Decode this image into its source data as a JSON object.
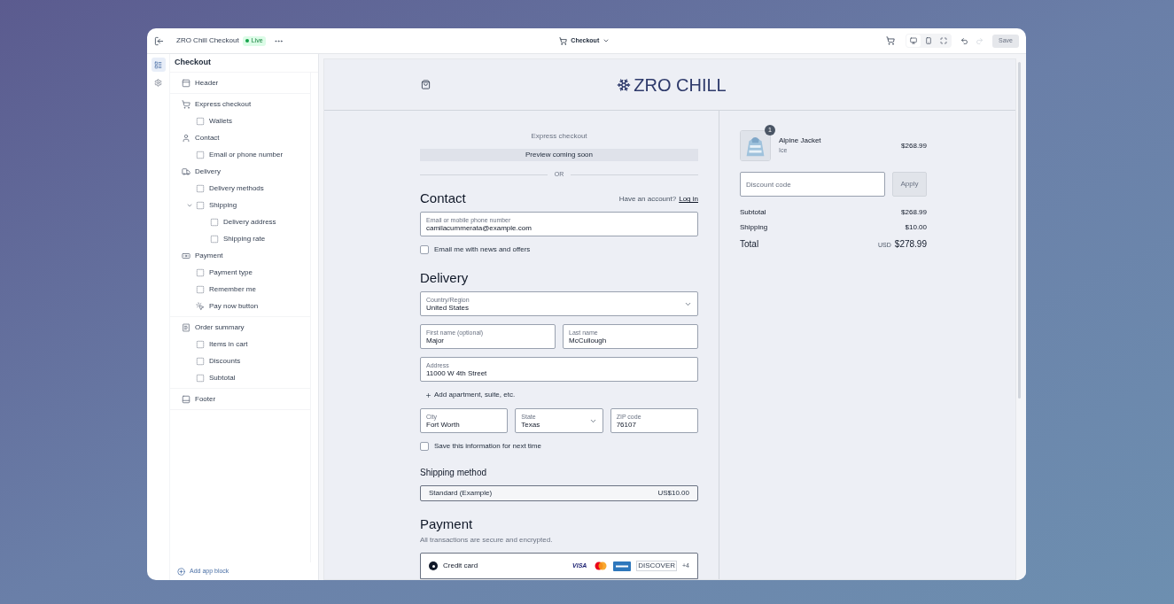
{
  "topbar": {
    "title": "ZRO Chill Checkout",
    "status": "Live",
    "page": "Checkout",
    "save": "Save",
    "save_disabled": true,
    "redo_disabled": true,
    "devices": [
      {
        "kind": "desktop",
        "selected": true
      },
      {
        "kind": "mobile",
        "selected": false
      },
      {
        "kind": "fullscreen",
        "selected": false
      }
    ]
  },
  "rail": [
    {
      "kind": "sections",
      "selected": true
    },
    {
      "kind": "settings",
      "selected": false
    }
  ],
  "sidebar": {
    "title": "Checkout",
    "groups": [
      [
        {
          "kind": "header",
          "label": "Header"
        }
      ],
      [
        {
          "kind": "cart",
          "label": "Express checkout",
          "children": [
            {
              "kind": "block",
              "label": "Wallets"
            }
          ]
        },
        {
          "kind": "person",
          "label": "Contact",
          "children": [
            {
              "kind": "block",
              "label": "Email or phone number"
            }
          ]
        },
        {
          "kind": "truck",
          "label": "Delivery",
          "children": [
            {
              "kind": "block",
              "label": "Delivery methods"
            },
            {
              "kind": "block",
              "label": "Shipping",
              "expanded": true,
              "children": [
                {
                  "kind": "block",
                  "label": "Delivery address"
                },
                {
                  "kind": "block",
                  "label": "Shipping rate"
                }
              ]
            }
          ]
        },
        {
          "kind": "cash",
          "label": "Payment",
          "children": [
            {
              "kind": "block",
              "label": "Payment type"
            },
            {
              "kind": "block",
              "label": "Remember me"
            },
            {
              "kind": "button",
              "label": "Pay now button"
            }
          ]
        }
      ],
      [
        {
          "kind": "receipt",
          "label": "Order summary",
          "children": [
            {
              "kind": "block",
              "label": "Items in cart"
            },
            {
              "kind": "block",
              "label": "Discounts"
            },
            {
              "kind": "block",
              "label": "Subtotal"
            }
          ]
        }
      ],
      [
        {
          "kind": "footer",
          "label": "Footer"
        }
      ]
    ],
    "add_block": "Add app block"
  },
  "preview": {
    "brand": "ZRO CHILL",
    "express": {
      "title": "Express checkout",
      "placeholder": "Preview coming soon",
      "divider": "OR"
    },
    "contact": {
      "heading": "Contact",
      "account_prompt": "Have an account?",
      "login": "Log in",
      "email": {
        "label": "Email or mobile phone number",
        "value": "camilacummerata@example.com"
      },
      "news": {
        "label": "Email me with news and offers",
        "checked": false
      }
    },
    "delivery": {
      "heading": "Delivery",
      "rows": [
        [
          {
            "kind": "select",
            "label": "Country/Region",
            "value": "United States"
          }
        ],
        [
          {
            "kind": "text",
            "label": "First name (optional)",
            "value": "Major"
          },
          {
            "kind": "text",
            "label": "Last name",
            "value": "McCullough"
          }
        ],
        [
          {
            "kind": "text",
            "label": "Address",
            "value": "11000 W 4th Street"
          }
        ],
        [
          {
            "kind": "link",
            "label": "Add apartment, suite, etc."
          }
        ],
        [
          {
            "kind": "text",
            "label": "City",
            "value": "Fort Worth"
          },
          {
            "kind": "select",
            "label": "State",
            "value": "Texas"
          },
          {
            "kind": "text",
            "label": "ZIP code",
            "value": "76107"
          }
        ]
      ],
      "save": {
        "label": "Save this information for next time",
        "checked": false
      }
    },
    "shipping": {
      "heading": "Shipping method",
      "option": {
        "name": "Standard (Example)",
        "price": "US$10.00"
      }
    },
    "payment": {
      "heading": "Payment",
      "note": "All transactions are secure and encrypted.",
      "method": {
        "name": "Credit card",
        "selected": true,
        "brands": [
          {
            "kind": "visa",
            "text": "VISA"
          },
          {
            "kind": "mastercard"
          },
          {
            "kind": "amex"
          },
          {
            "kind": "discover",
            "text": "DISCOVER"
          },
          {
            "kind": "more",
            "text": "+4"
          }
        ]
      }
    },
    "summary": {
      "item": {
        "name": "Alpine Jacket",
        "variant": "Ice",
        "price": "$268.99",
        "quantity": "1"
      },
      "discount": {
        "placeholder": "Discount code",
        "button": "Apply"
      },
      "lines": [
        {
          "label": "Subtotal",
          "value": "$268.99"
        },
        {
          "label": "Shipping",
          "value": "$10.00"
        }
      ],
      "total": {
        "label": "Total",
        "currency": "USD",
        "value": "$278.99"
      }
    }
  }
}
